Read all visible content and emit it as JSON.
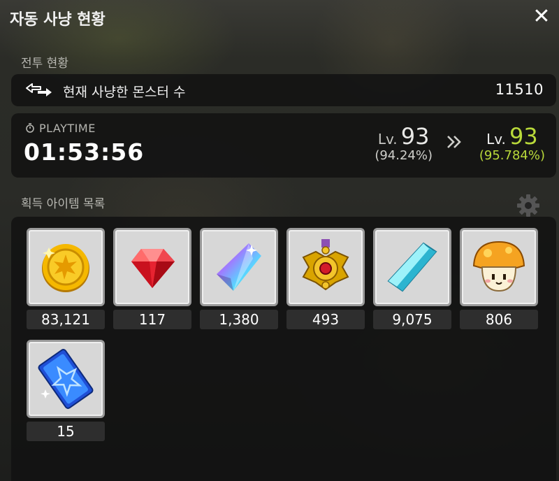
{
  "window": {
    "title": "자동 사냥 현황",
    "close_icon": "close-icon"
  },
  "battle": {
    "section_label": "전투 현황",
    "hunted_label": "현재 사냥한 몬스터 수",
    "hunted_value": "11510",
    "playtime_label": "PLAYTIME",
    "playtime_value": "01:53:56",
    "level_before": {
      "prefix": "Lv.",
      "level": "93",
      "percent": "(94.24%)"
    },
    "level_after": {
      "prefix": "Lv.",
      "level": "93",
      "percent": "(95.784%)"
    },
    "accent_color": "#b9d93a"
  },
  "items": {
    "section_label": "획득 아이템 목록",
    "settings_icon": "gear-icon",
    "list": [
      {
        "icon": "gold-coin-icon",
        "count": "83,121"
      },
      {
        "icon": "red-gem-icon",
        "count": "117"
      },
      {
        "icon": "rainbow-crystal-icon",
        "count": "1,380"
      },
      {
        "icon": "gold-medal-icon",
        "count": "493"
      },
      {
        "icon": "blue-crystal-icon",
        "count": "9,075"
      },
      {
        "icon": "orange-mushroom-icon",
        "count": "806"
      },
      {
        "icon": "blue-card-icon",
        "count": "15"
      }
    ]
  }
}
